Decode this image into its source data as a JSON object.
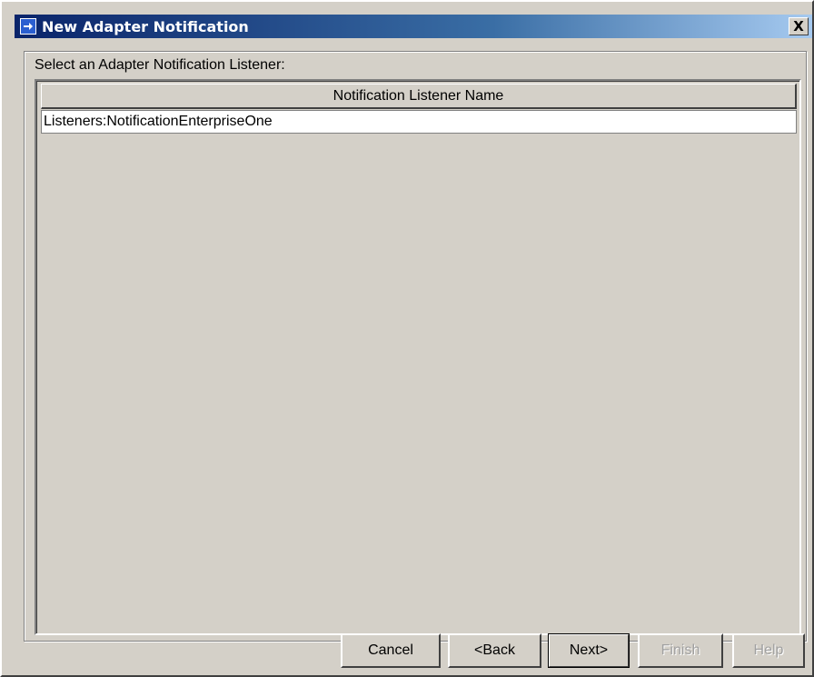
{
  "window": {
    "title": "New Adapter Notification",
    "close_label": "X",
    "title_icon": "arrow-right-icon"
  },
  "prompt": "Select an Adapter Notification Listener:",
  "table": {
    "column_header": "Notification Listener Name",
    "rows": [
      "Listeners:NotificationEnterpriseOne"
    ]
  },
  "buttons": {
    "cancel": "Cancel",
    "back": "<Back",
    "next": "Next>",
    "finish": "Finish",
    "help": "Help"
  }
}
